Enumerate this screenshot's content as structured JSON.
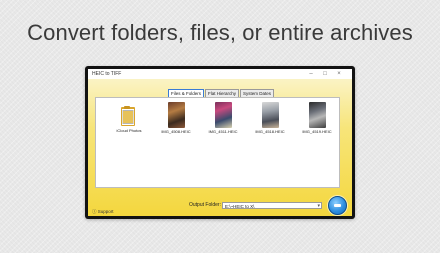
{
  "headline": "Convert folders, files, or entire archives",
  "window": {
    "title": "HEIC to TIFF",
    "controls": {
      "minimize": "–",
      "maximize": "□",
      "close": "×"
    }
  },
  "tabs": [
    {
      "label": "Files & Folders",
      "active": true
    },
    {
      "label": "Flat Hierarchy",
      "active": false
    },
    {
      "label": "System Dates",
      "active": false
    }
  ],
  "files": [
    {
      "label": "iCloud Photos",
      "kind": "folder"
    },
    {
      "label": "IMG_4508.HEIC",
      "kind": "image"
    },
    {
      "label": "IMG_4511.HEIC",
      "kind": "image"
    },
    {
      "label": "IMG_4518.HEIC",
      "kind": "image"
    },
    {
      "label": "IMG_4519.HEIC",
      "kind": "image"
    }
  ],
  "output": {
    "label": "Output Folder:",
    "value": "E:\\~HEIC to X\\"
  },
  "support_label": "Support",
  "colors": {
    "accent": "#2f8fe0",
    "window_frame": "#121212",
    "background_top": "#fbf6d4",
    "background_bottom": "#f4d73e"
  }
}
